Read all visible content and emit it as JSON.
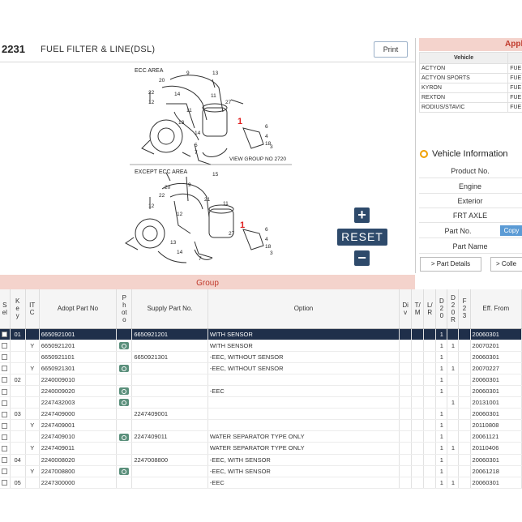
{
  "header": {
    "group_code": "2231",
    "group_title": "FUEL FILTER & LINE(DSL)",
    "print_label": "Print"
  },
  "diagram": {
    "top_area_label": "ECC AREA",
    "bottom_area_label": "EXCEPT ECC AREA",
    "view_label": "VIEW GROUP NO 2720",
    "zoom_in_label": "+",
    "zoom_out_label": "−",
    "reset_label": "RESET",
    "callout_color": "#e02020"
  },
  "application": {
    "title": "Appli",
    "header_vehicle": "Vehicle",
    "rows": [
      {
        "vehicle": "ACTYON",
        "spec": "FUE"
      },
      {
        "vehicle": "ACTYON SPORTS",
        "spec": "FUE"
      },
      {
        "vehicle": "KYRON",
        "spec": "FUE"
      },
      {
        "vehicle": "REXTON",
        "spec": "FUE"
      },
      {
        "vehicle": "RODIUS/STAVIC",
        "spec": "FUE"
      }
    ]
  },
  "vehicle_info": {
    "title": "Vehicle Information",
    "rows": [
      "Product No.",
      "Engine",
      "Exterior",
      "FRT AXLE",
      "Part No.",
      "Part Name"
    ],
    "copy_label": "Copy",
    "part_details_label": "> Part Details",
    "coll_label": "> Colle"
  },
  "group_bar": {
    "label": "Group"
  },
  "parts_table": {
    "headers": {
      "sel": "Sel",
      "key": "Key",
      "itc": "ITC",
      "adopt": "Adopt Part No",
      "photo": "Photo",
      "supply": "Supply Part No.",
      "option": "Option",
      "div": "Div",
      "tm": "T/M",
      "lr": "L/R",
      "d20": "D20",
      "d20r": "D20R",
      "f23": "F23",
      "eff": "Eff. From"
    },
    "rows": [
      {
        "key": "01",
        "itc": "",
        "adopt": "6650921001",
        "photo": false,
        "supply": "6650921201",
        "option": "WITH SENSOR",
        "d20": "1",
        "d20r": "",
        "eff": "20060301",
        "selected": true
      },
      {
        "key": "",
        "itc": "Y",
        "adopt": "6650921201",
        "photo": true,
        "supply": "",
        "option": "WITH SENSOR",
        "d20": "1",
        "d20r": "1",
        "eff": "20070201",
        "selected": false
      },
      {
        "key": "",
        "itc": "",
        "adopt": "6650921101",
        "photo": false,
        "supply": "6650921301",
        "option": "-EEC, WITHOUT SENSOR",
        "d20": "1",
        "d20r": "",
        "eff": "20060301",
        "selected": false
      },
      {
        "key": "",
        "itc": "Y",
        "adopt": "6650921301",
        "photo": true,
        "supply": "",
        "option": "-EEC, WITHOUT SENSOR",
        "d20": "1",
        "d20r": "1",
        "eff": "20070227",
        "selected": false
      },
      {
        "key": "02",
        "itc": "",
        "adopt": "2240009010",
        "photo": false,
        "supply": "",
        "option": "",
        "d20": "1",
        "d20r": "",
        "eff": "20060301",
        "selected": false
      },
      {
        "key": "",
        "itc": "",
        "adopt": "2240009020",
        "photo": true,
        "supply": "",
        "option": "-EEC",
        "d20": "1",
        "d20r": "",
        "eff": "20060301",
        "selected": false
      },
      {
        "key": "",
        "itc": "",
        "adopt": "2247432003",
        "photo": true,
        "supply": "",
        "option": "",
        "d20": "",
        "d20r": "1",
        "eff": "20131001",
        "selected": false
      },
      {
        "key": "03",
        "itc": "",
        "adopt": "2247409000",
        "photo": false,
        "supply": "2247409001",
        "option": "",
        "d20": "1",
        "d20r": "",
        "eff": "20060301",
        "selected": false
      },
      {
        "key": "",
        "itc": "Y",
        "adopt": "2247409001",
        "photo": false,
        "supply": "",
        "option": "",
        "d20": "1",
        "d20r": "",
        "eff": "20110808",
        "selected": false
      },
      {
        "key": "",
        "itc": "",
        "adopt": "2247409010",
        "photo": true,
        "supply": "2247409011",
        "option": "WATER SEPARATOR TYPE ONLY",
        "d20": "1",
        "d20r": "",
        "eff": "20061121",
        "selected": false
      },
      {
        "key": "",
        "itc": "Y",
        "adopt": "2247409011",
        "photo": false,
        "supply": "",
        "option": "WATER SEPARATOR TYPE ONLY",
        "d20": "1",
        "d20r": "1",
        "eff": "20110406",
        "selected": false
      },
      {
        "key": "04",
        "itc": "",
        "adopt": "2240008020",
        "photo": false,
        "supply": "2247008800",
        "option": "-EEC, WITH SENSOR",
        "d20": "1",
        "d20r": "",
        "eff": "20060301",
        "selected": false
      },
      {
        "key": "",
        "itc": "Y",
        "adopt": "2247008800",
        "photo": true,
        "supply": "",
        "option": "-EEC, WITH SENSOR",
        "d20": "1",
        "d20r": "",
        "eff": "20061218",
        "selected": false
      },
      {
        "key": "05",
        "itc": "",
        "adopt": "2247300000",
        "photo": false,
        "supply": "",
        "option": "-EEC",
        "d20": "1",
        "d20r": "1",
        "eff": "20060301",
        "selected": false
      }
    ]
  }
}
